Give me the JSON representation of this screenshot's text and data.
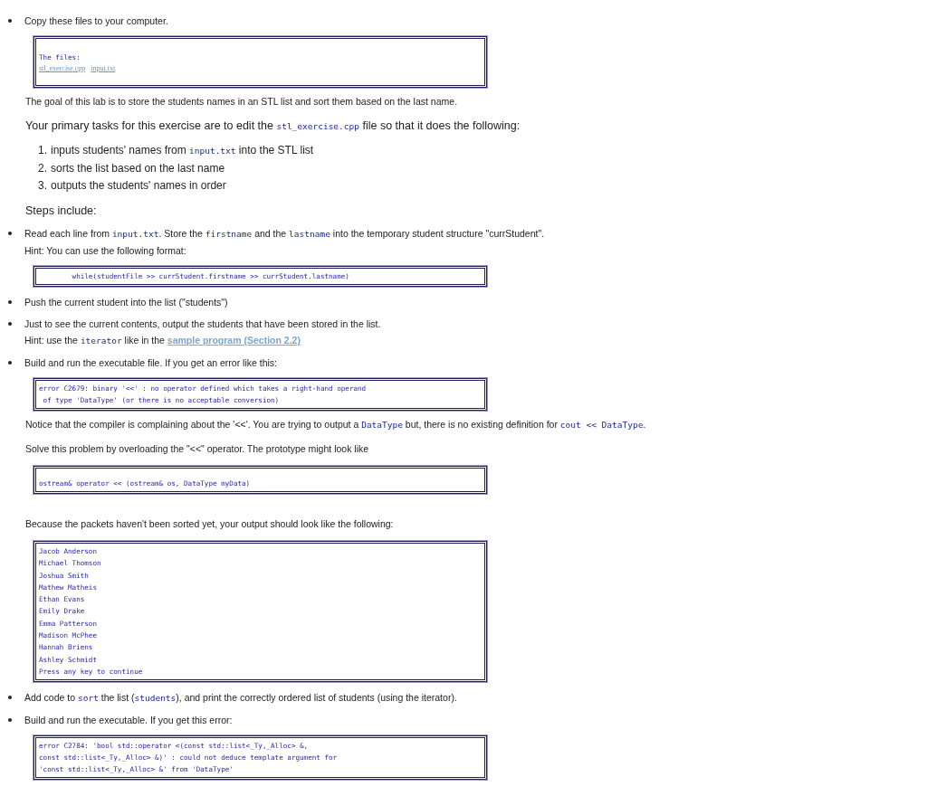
{
  "blocks": [
    {
      "kind": "bullet",
      "lines": [
        [
          {
            "kind": "text",
            "t": "Copy these files to your computer."
          }
        ]
      ]
    },
    {
      "kind": "filebox",
      "heading": "The files:",
      "links": [
        "stl_exercise.cpp",
        "input.txt"
      ]
    },
    {
      "kind": "para",
      "lines": [
        [
          {
            "kind": "text",
            "t": "The goal of this lab is to store the students names in an STL list and sort them based on the last name."
          }
        ]
      ]
    },
    {
      "kind": "lead",
      "lines": [
        [
          {
            "kind": "text",
            "t": "Your primary tasks for this exercise are to edit the "
          },
          {
            "kind": "code",
            "t": "stl_exercise.cpp"
          },
          {
            "kind": "text",
            "t": " file so that it does the following:"
          }
        ]
      ]
    },
    {
      "kind": "ordered",
      "items": [
        {
          "number": "1.",
          "text": [
            {
              "kind": "text",
              "t": "inputs students' names from "
            },
            {
              "kind": "code",
              "t": "input.txt"
            },
            {
              "kind": "text",
              "t": " into the STL list"
            }
          ]
        },
        {
          "number": "2.",
          "text": [
            {
              "kind": "text",
              "t": "sorts the list based on the last name"
            }
          ]
        },
        {
          "number": "3.",
          "text": [
            {
              "kind": "text",
              "t": "outputs the students' names in order"
            }
          ]
        }
      ]
    },
    {
      "kind": "lead",
      "lines": [
        [
          {
            "kind": "text",
            "t": "Steps include:"
          }
        ]
      ]
    },
    {
      "kind": "bullet",
      "lines": [
        [
          {
            "kind": "text",
            "t": "Read each line from "
          },
          {
            "kind": "code",
            "t": "input.txt"
          },
          {
            "kind": "text",
            "t": ". Store the "
          },
          {
            "kind": "code",
            "t": "firstname"
          },
          {
            "kind": "text",
            "t": " and the "
          },
          {
            "kind": "code",
            "t": "lastname"
          },
          {
            "kind": "text",
            "t": " into the temporary student structure \"currStudent\"."
          }
        ],
        [
          {
            "kind": "text",
            "t": "Hint: You can use the following format:"
          }
        ]
      ]
    },
    {
      "kind": "codebox",
      "lines": [
        "        while(studentFile >> currStudent.firstname >> currStudent.lastname)"
      ]
    },
    {
      "kind": "bullet",
      "lines": [
        [
          {
            "kind": "text",
            "t": "Push the current student into the list (\"students\")"
          }
        ]
      ]
    },
    {
      "kind": "bullet",
      "lines": [
        [
          {
            "kind": "text",
            "t": "Just to see the current contents, output the students that have been stored in the list."
          }
        ],
        [
          {
            "kind": "text",
            "t": "Hint: use the "
          },
          {
            "kind": "code",
            "t": "iterator"
          },
          {
            "kind": "text",
            "t": " like in the "
          },
          {
            "kind": "link",
            "t": "sample program (Section 2.2)"
          }
        ]
      ]
    },
    {
      "kind": "bullet",
      "lines": [
        [
          {
            "kind": "text",
            "t": "Build and run the executable file. If you get an error like this:"
          }
        ]
      ]
    },
    {
      "kind": "codebox",
      "lines": [
        "error C2679: binary '<<' : no operator defined which takes a right-hand operand",
        " of type 'DataType' (or there is no acceptable conversion)"
      ]
    },
    {
      "kind": "para",
      "lines": [
        [
          {
            "kind": "text",
            "t": "Notice that the compiler is complaining about the '<<'. You are trying to output a "
          },
          {
            "kind": "code",
            "t": "DataType"
          },
          {
            "kind": "text",
            "t": " but, there is no existing definition for "
          },
          {
            "kind": "code",
            "t": "cout << DataType"
          },
          {
            "kind": "text",
            "t": "."
          }
        ]
      ]
    },
    {
      "kind": "para",
      "lines": [
        [
          {
            "kind": "text",
            "t": "Solve this problem by overloading the \"<<\" operator. The prototype might look like"
          }
        ]
      ]
    },
    {
      "kind": "protobox",
      "lines": [
        "ostream& operator << (ostream& os, DataType myData)"
      ]
    },
    {
      "kind": "para",
      "lines": [
        [
          {
            "kind": "text",
            "t": "Because the packets haven't been sorted yet, your output should look like the following:"
          }
        ]
      ]
    },
    {
      "kind": "outputbox",
      "lines": [
        "Jacob Anderson",
        "Michael Thomson",
        "Joshua Smith",
        "Mathew Matheis",
        "Ethan Evans",
        "Emily Drake",
        "Emma Patterson",
        "Madison McPhee",
        "Hannah Briens",
        "Ashley Schmidt",
        "Press any key to continue"
      ]
    },
    {
      "kind": "bullet",
      "lines": [
        [
          {
            "kind": "text",
            "t": "Add code to "
          },
          {
            "kind": "code",
            "t": "sort"
          },
          {
            "kind": "text",
            "t": " the list ("
          },
          {
            "kind": "code",
            "t": "students"
          },
          {
            "kind": "text",
            "t": "), and print the correctly ordered list of students (using the iterator)."
          }
        ]
      ]
    },
    {
      "kind": "bullet",
      "lines": [
        [
          {
            "kind": "text",
            "t": "Build and run the executable. If you get this error:"
          }
        ]
      ]
    },
    {
      "kind": "codebox",
      "lines": [
        "error C2784: 'bool std::operator <(const std::list<_Ty,_Alloc> &,",
        "const std::list<_Ty,_Alloc> &)' : could not deduce template argument for",
        "'const std::list<_Ty,_Alloc> &' from 'DataType'"
      ]
    }
  ]
}
